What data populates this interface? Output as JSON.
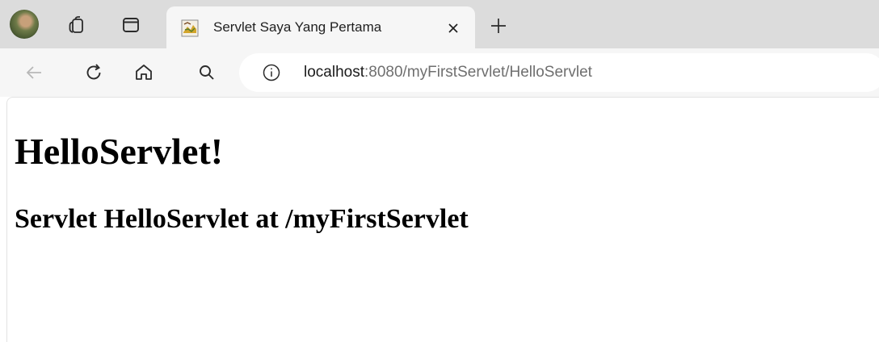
{
  "browser": {
    "tab": {
      "title": "Servlet Saya Yang Pertama",
      "favicon": "tomcat-icon"
    },
    "new_tab_icon": "plus-icon",
    "toolbar_icons": [
      "back-arrow-icon",
      "reload-icon",
      "home-icon",
      "search-icon"
    ],
    "address": {
      "host": "localhost",
      "rest": ":8080/myFirstServlet/HelloServlet",
      "site_info_icon": "info-icon"
    }
  },
  "page": {
    "heading": "HelloServlet!",
    "subheading": "Servlet HelloServlet at /myFirstServlet"
  }
}
